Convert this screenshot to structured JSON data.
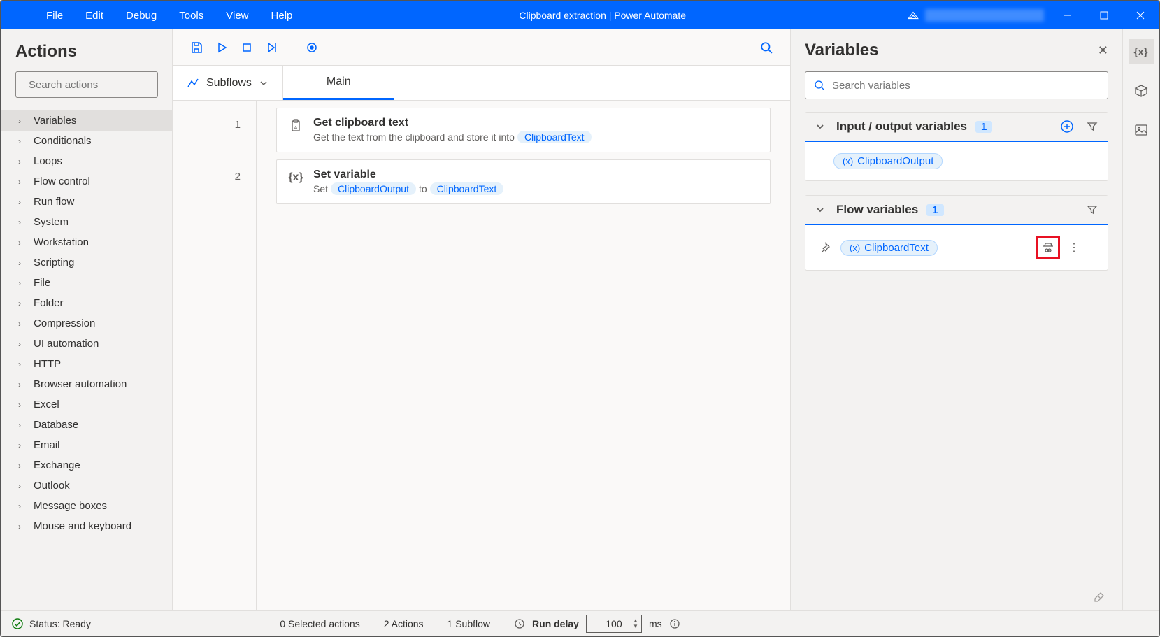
{
  "titlebar": {
    "menus": [
      "File",
      "Edit",
      "Debug",
      "Tools",
      "View",
      "Help"
    ],
    "title": "Clipboard extraction | Power Automate"
  },
  "actions_panel": {
    "header": "Actions",
    "search_placeholder": "Search actions",
    "categories": [
      "Variables",
      "Conditionals",
      "Loops",
      "Flow control",
      "Run flow",
      "System",
      "Workstation",
      "Scripting",
      "File",
      "Folder",
      "Compression",
      "UI automation",
      "HTTP",
      "Browser automation",
      "Excel",
      "Database",
      "Email",
      "Exchange",
      "Outlook",
      "Message boxes",
      "Mouse and keyboard"
    ]
  },
  "editor": {
    "subflows_label": "Subflows",
    "tab_main": "Main",
    "steps": [
      {
        "num": "1",
        "title": "Get clipboard text",
        "desc_prefix": "Get the text from the clipboard and store it into",
        "var": "ClipboardText"
      },
      {
        "num": "2",
        "title": "Set variable",
        "desc_prefix": "Set",
        "var1": "ClipboardOutput",
        "mid": "to",
        "var2": "ClipboardText"
      }
    ]
  },
  "variables_panel": {
    "header": "Variables",
    "search_placeholder": "Search variables",
    "sections": {
      "io": {
        "title": "Input / output variables",
        "count": "1",
        "chip": "ClipboardOutput"
      },
      "flow": {
        "title": "Flow variables",
        "count": "1",
        "chip": "ClipboardText"
      }
    }
  },
  "statusbar": {
    "status": "Status: Ready",
    "selected": "0 Selected actions",
    "actions": "2 Actions",
    "subflows": "1 Subflow",
    "run_delay_label": "Run delay",
    "run_delay_value": "100",
    "ms": "ms"
  }
}
